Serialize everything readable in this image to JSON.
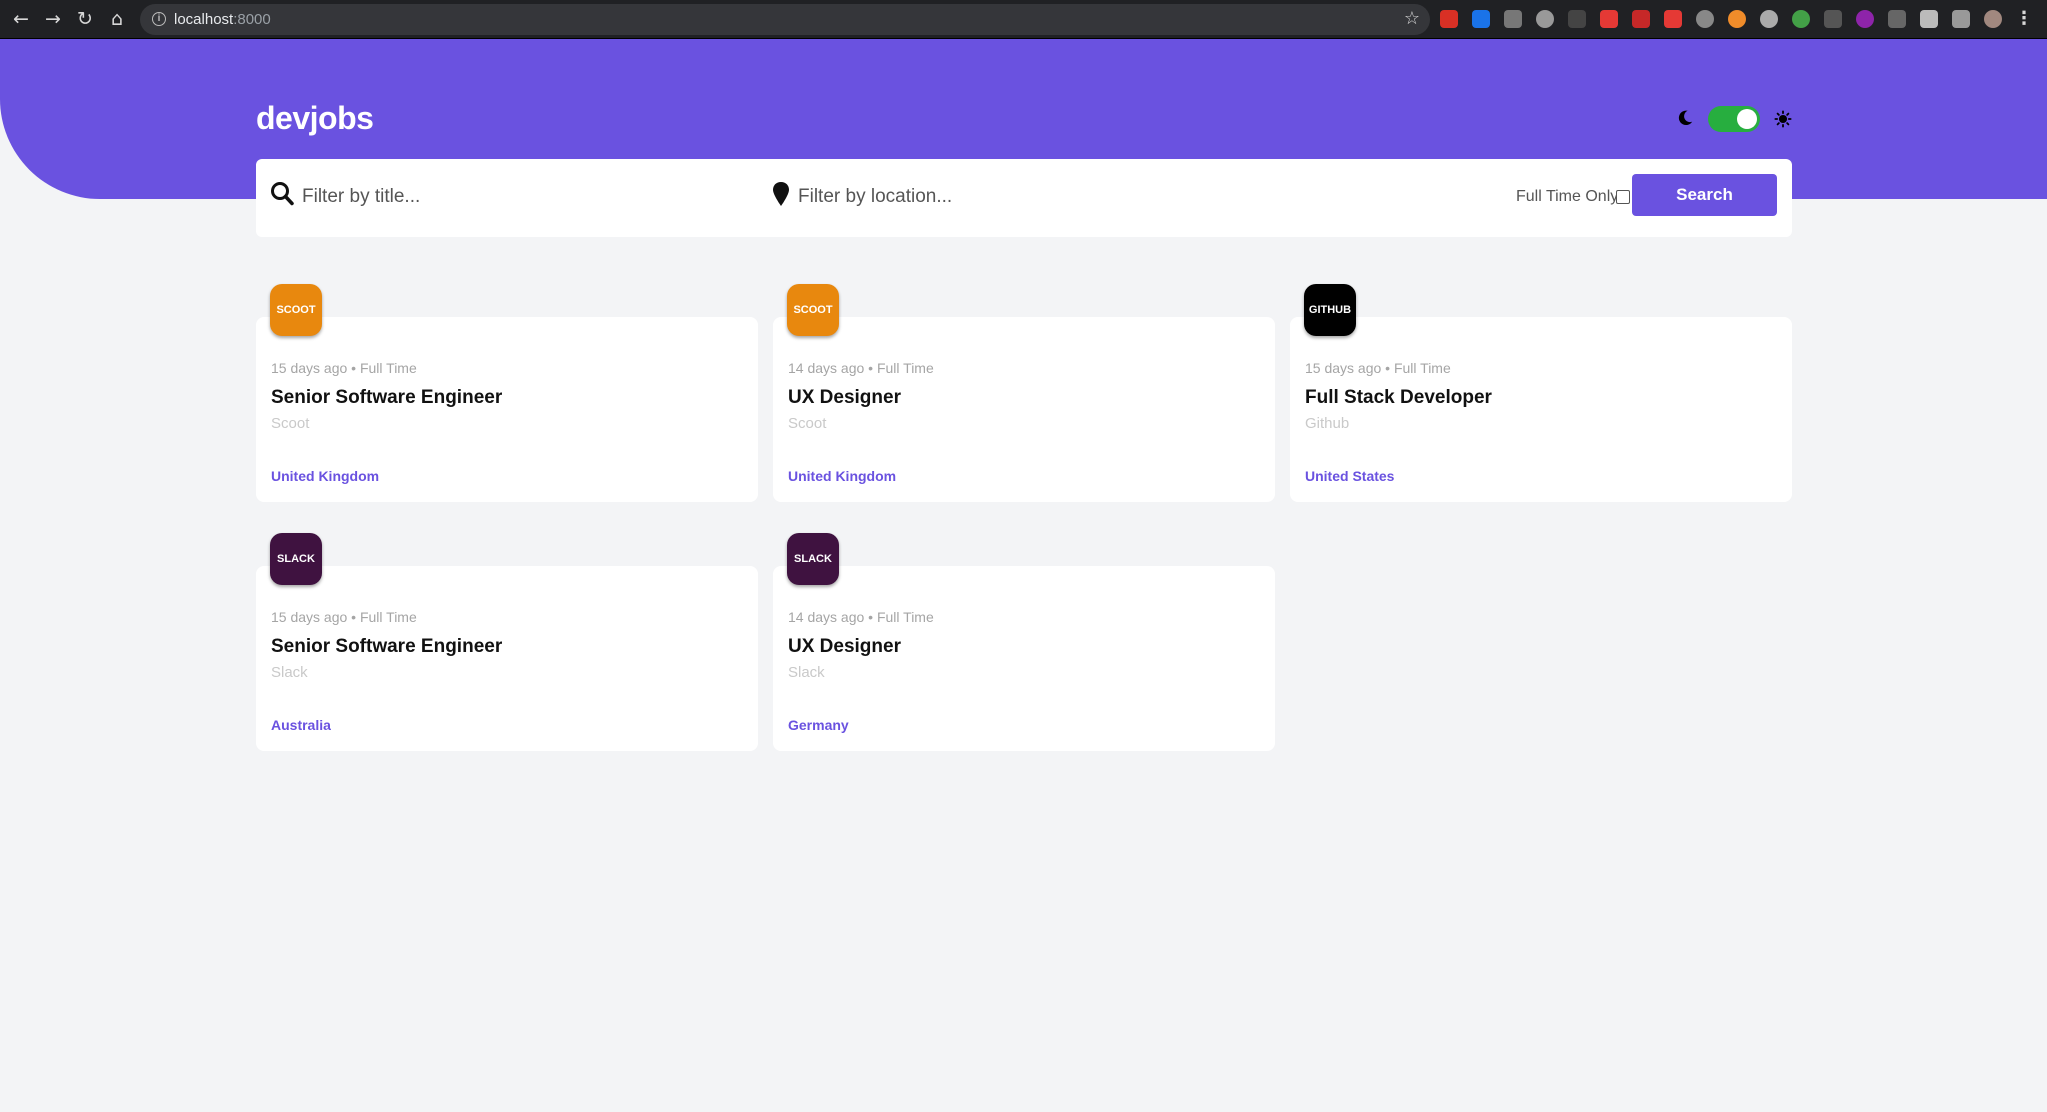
{
  "browser": {
    "url_host": "localhost",
    "url_port": ":8000"
  },
  "app": {
    "logo": "devjobs",
    "brand_color": "#6a52e0",
    "toggle_color": "#27ae3f",
    "theme_toggle_state": "on"
  },
  "filters": {
    "title_placeholder": "Filter by title...",
    "location_placeholder": "Filter by location...",
    "fulltime_label": "Full Time Only",
    "fulltime_checked": false,
    "search_label": "Search"
  },
  "jobs": [
    {
      "logo_text": "SCOOT",
      "logo_color": "#e8880e",
      "meta": "15 days ago • Full Time",
      "title": "Senior Software Engineer",
      "company": "Scoot",
      "location": "United Kingdom"
    },
    {
      "logo_text": "SCOOT",
      "logo_color": "#e8880e",
      "meta": "14 days ago • Full Time",
      "title": "UX Designer",
      "company": "Scoot",
      "location": "United Kingdom"
    },
    {
      "logo_text": "GITHUB",
      "logo_color": "#000000",
      "meta": "15 days ago • Full Time",
      "title": "Full Stack Developer",
      "company": "Github",
      "location": "United States"
    },
    {
      "logo_text": "SLACK",
      "logo_color": "#3f1240",
      "meta": "15 days ago • Full Time",
      "title": "Senior Software Engineer",
      "company": "Slack",
      "location": "Australia"
    },
    {
      "logo_text": "SLACK",
      "logo_color": "#3f1240",
      "meta": "14 days ago • Full Time",
      "title": "UX Designer",
      "company": "Slack",
      "location": "Germany"
    }
  ]
}
